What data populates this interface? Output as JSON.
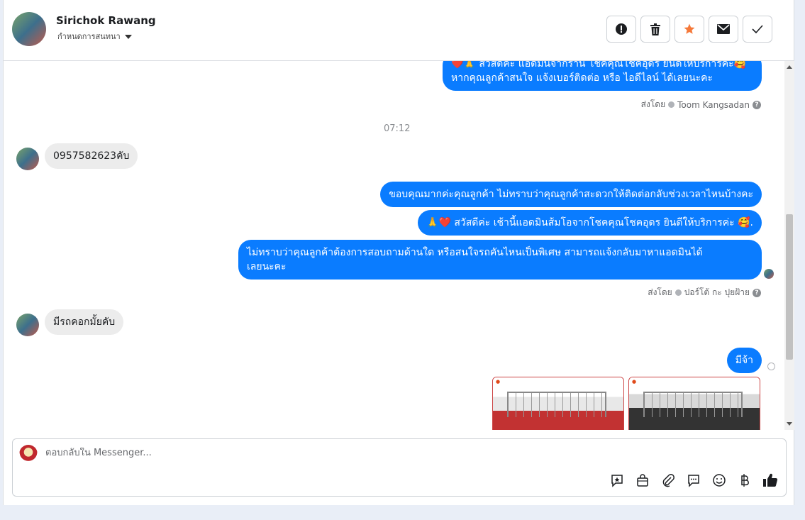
{
  "header": {
    "name": "Sirichok Rawang",
    "subtitle": "กำหนดการสนทนา"
  },
  "thread": {
    "msg1_line1": "❤️🙏 สวัสดีค่ะ แอดมินจากร้าน โชคคุณโชคอุดร ยินดีให้บริการค่ะ🥰",
    "msg1_line2": "หากคุณลูกค้าสนใจ แจ้งเบอร์ติดต่อ หรือ ไอดีไลน์ ได้เลยนะคะ",
    "sent_by_label": "ส่งโดย",
    "sent_by_1": "Toom Kangsadan",
    "time": "07:12",
    "customer_msg1": "0957582623คับ",
    "reply1": "ขอบคุณมากค่ะคุณลูกค้า ไม่ทราบว่าคุณลูกค้าสะดวกให้ติดต่อกลับช่วงเวลาไหนบ้างคะ",
    "reply2": "🙏❤️ สวัสดีค่ะ เช้านี้แอดมินส้มโอจากโชคคุณโชคอุดร ยินดีให้บริการค่ะ 🥰.",
    "reply3_line1": "ไม่ทราบว่าคุณลูกค้าต้องการสอบถามด้านใด หรือสนใจรถคันไหนเป็นพิเศษ สามารถแจ้งกลับมาหาแอดมินได้",
    "reply3_line2": "เลยนะคะ",
    "sent_by_2": "ปอร์โต้ กะ ปุยฝ้าย",
    "customer_msg2": "มีรถคอกมั้ยคับ",
    "reply4": "มีจ้า"
  },
  "composer": {
    "placeholder": "ตอบกลับใน Messenger..."
  },
  "icons": {
    "header_actions": [
      "alert-icon",
      "trash-icon",
      "star-icon",
      "envelope-icon",
      "check-icon"
    ],
    "composer_tools": [
      "sticker-icon",
      "shop-icon",
      "attach-icon",
      "chat-icon",
      "emoji-icon",
      "baht-icon",
      "like-icon"
    ]
  },
  "colors": {
    "outgoing": "#0a7cff",
    "incoming": "#ececec",
    "star": "#f5793a"
  }
}
